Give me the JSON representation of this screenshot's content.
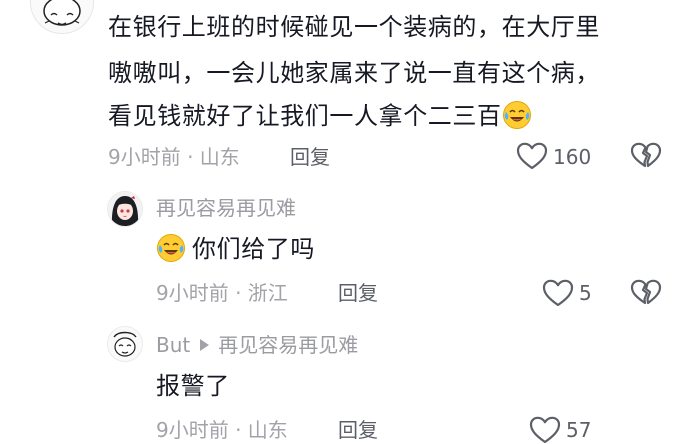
{
  "comment": {
    "lines": [
      "在银行上班的时候碰见一个装病的，在大厅里",
      "嗷嗷叫，一会儿她家属来了说一直有这个病，",
      "看见钱就好了让我们一人拿个二三百"
    ],
    "time_location": "9小时前 · 山东",
    "reply_label": "回复",
    "like_count": "160"
  },
  "reply1": {
    "username": "再见容易再见难",
    "text": "你们给了吗",
    "time_location": "9小时前 · 浙江",
    "reply_label": "回复",
    "like_count": "5"
  },
  "reply2": {
    "username": "But",
    "reply_to": "再见容易再见难",
    "text": "报警了",
    "time_location": "9小时前 · 山东",
    "reply_label": "回复",
    "like_count": "57"
  },
  "icons": {
    "like": "heart-outline-icon",
    "dislike": "broken-heart-icon",
    "emoji": "crying-laughing-emoji"
  },
  "colors": {
    "text": "#161823",
    "meta": "#a2a3a8",
    "action": "#5c5f67"
  }
}
